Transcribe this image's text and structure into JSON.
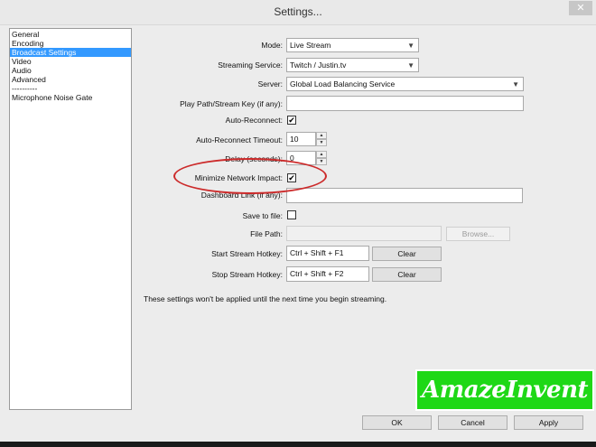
{
  "window": {
    "title": "Settings...",
    "close_glyph": "✕"
  },
  "sidebar": {
    "items": [
      {
        "label": "General",
        "selected": false
      },
      {
        "label": "Encoding",
        "selected": false
      },
      {
        "label": "Broadcast Settings",
        "selected": true
      },
      {
        "label": "Video",
        "selected": false
      },
      {
        "label": "Audio",
        "selected": false
      },
      {
        "label": "Advanced",
        "selected": false
      },
      {
        "label": "----------",
        "selected": false
      },
      {
        "label": "Microphone Noise Gate",
        "selected": false
      }
    ]
  },
  "form": {
    "mode": {
      "label": "Mode:",
      "value": "Live Stream"
    },
    "streaming_service": {
      "label": "Streaming Service:",
      "value": "Twitch / Justin.tv"
    },
    "server": {
      "label": "Server:",
      "value": "Global Load Balancing Service"
    },
    "play_path": {
      "label": "Play Path/Stream Key (if any):",
      "value": ""
    },
    "auto_reconnect": {
      "label": "Auto-Reconnect:",
      "checked": true
    },
    "auto_reconnect_timeout": {
      "label": "Auto-Reconnect Timeout:",
      "value": "10"
    },
    "delay": {
      "label": "Delay (seconds):",
      "value": "0"
    },
    "minimize_network_impact": {
      "label": "Minimize Network Impact:",
      "checked": true
    },
    "dashboard_link": {
      "label": "Dashboard Link (if any):",
      "value": ""
    },
    "save_to_file": {
      "label": "Save to file:",
      "checked": false
    },
    "file_path": {
      "label": "File Path:",
      "value": "",
      "browse_label": "Browse..."
    },
    "start_hotkey": {
      "label": "Start Stream Hotkey:",
      "value": "Ctrl + Shift + F1",
      "clear_label": "Clear"
    },
    "stop_hotkey": {
      "label": "Stop Stream Hotkey:",
      "value": "Ctrl + Shift + F2",
      "clear_label": "Clear"
    }
  },
  "note": "These settings won't be applied until the next time you begin streaming.",
  "buttons": {
    "ok": "OK",
    "cancel": "Cancel",
    "apply": "Apply"
  },
  "icons": {
    "check": "✔",
    "caret": "▼",
    "spin_up": "▲",
    "spin_down": "▼"
  },
  "watermark": "AmazeInvent",
  "colors": {
    "selection": "#3399ff",
    "annotation": "#cc2a2a",
    "watermark_bg": "#1ed816"
  }
}
